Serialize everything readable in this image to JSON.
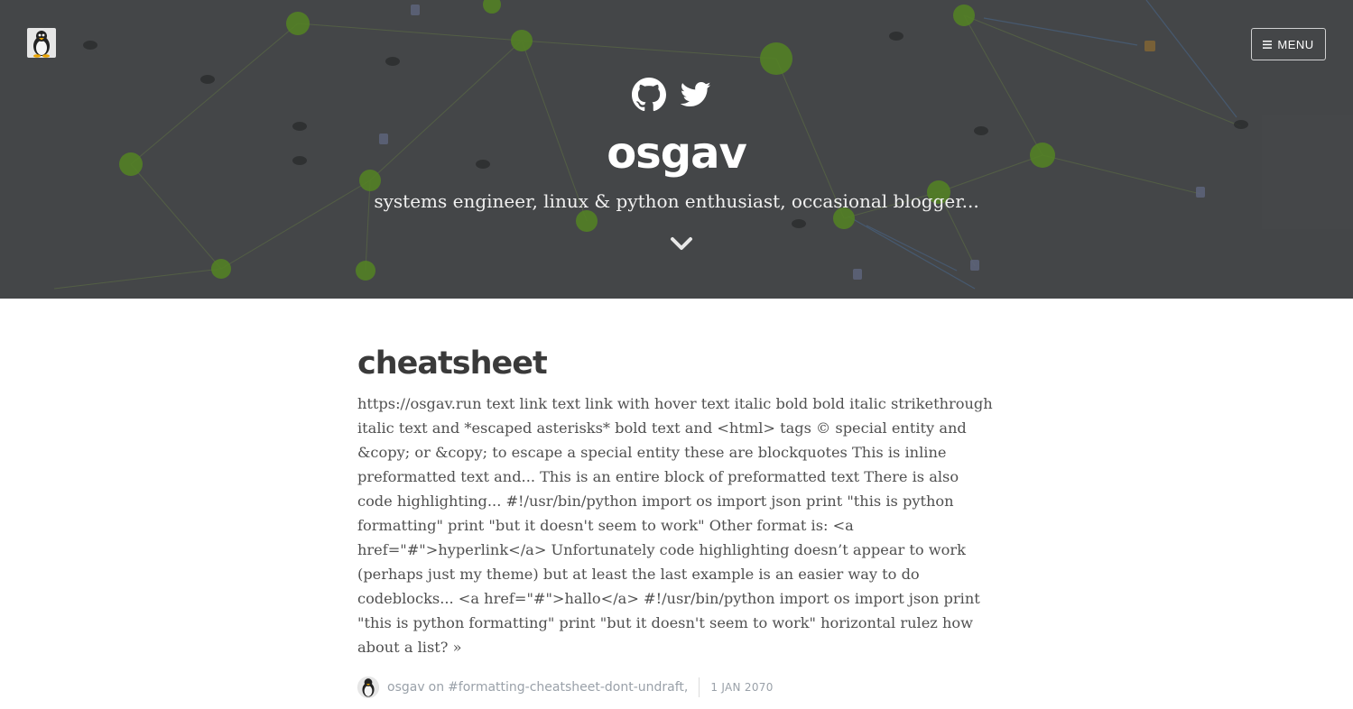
{
  "header": {
    "title": "osgav",
    "description": "systems engineer, linux & python enthusiast, occasional blogger...",
    "menu_label": "MENU",
    "menu_icon": "hamburger-icon",
    "social_icons": [
      "github-icon",
      "twitter-icon"
    ],
    "scroll_icon": "chevron-down-icon",
    "logo_icon": "tux-penguin-icon"
  },
  "post": {
    "title": "cheatsheet",
    "excerpt": "https://osgav.run text link text link with hover text italic bold bold italic strikethrough italic text and *escaped asterisks* bold text and <html> tags © special entity and &copy; or &copy; to escape a special entity these are blockquotes This is inline preformatted text and... This is an entire block of preformatted text There is also code highlighting... #!/usr/bin/python import os import json print \"this is python formatting\" print \"but it doesn't seem to work\" Other format is: <a href=\"#\">hyperlink</a> Unfortunately code highlighting doesn’t appear to work (perhaps just my theme) but at least the last example is an easier way to do codeblocks... <a href=\"#\">hallo</a> #!/usr/bin/python import os import json print \"this is python formatting\" print \"but it doesn't seem to work\" horizontal rulez how about a list? »",
    "author": "osgav",
    "on_word": "on",
    "tag": "#formatting-cheatsheet-dont-undraft,",
    "date": "1 JAN 2070"
  },
  "colors": {
    "header_bg": "#54575a",
    "title_text": "#3a3a3a",
    "body_text": "#505050",
    "meta_text": "#9aa1a9",
    "node_green": "#6ab023"
  }
}
